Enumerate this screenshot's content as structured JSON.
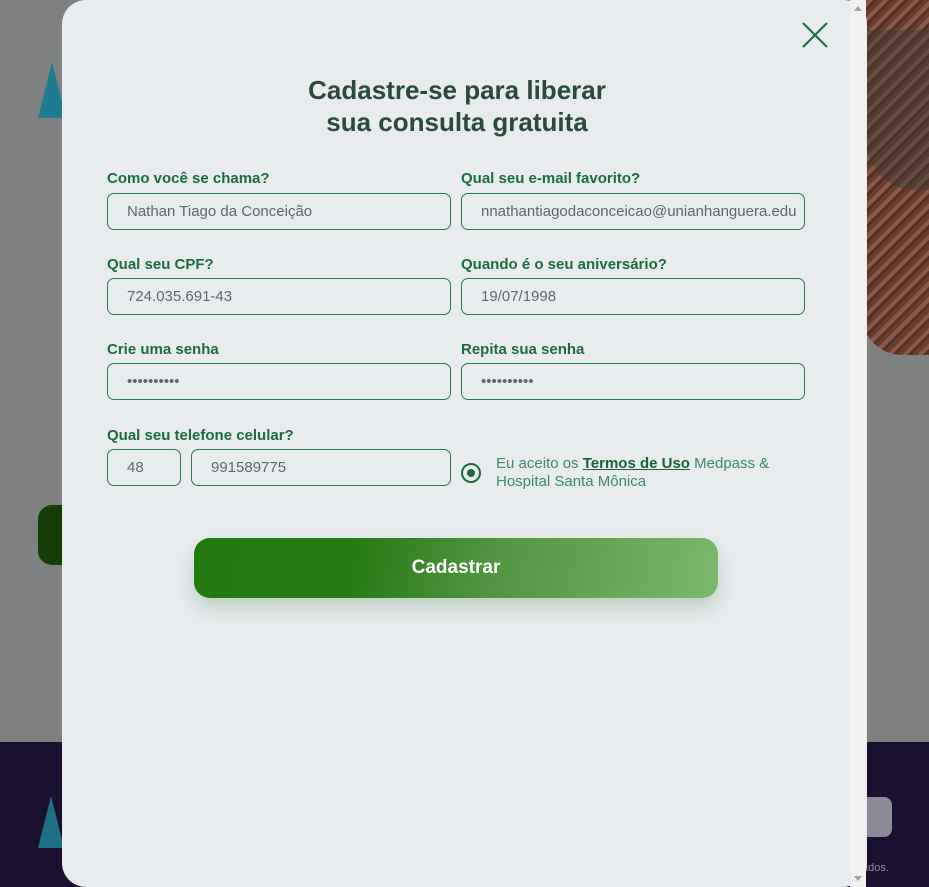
{
  "modal": {
    "title_line1": "Cadastre-se para liberar",
    "title_line2": "sua consulta gratuita",
    "close_icon": "close-icon"
  },
  "form": {
    "name": {
      "label": "Como você se chama?",
      "value": "Nathan Tiago da Conceição"
    },
    "email": {
      "label": "Qual seu e-mail favorito?",
      "value": "nnathantiagodaconceicao@unianhanguera.edu"
    },
    "cpf": {
      "label": "Qual seu CPF?",
      "value": "724.035.691-43"
    },
    "birthday": {
      "label": "Quando é o seu aniversário?",
      "value": "19/07/1998"
    },
    "password": {
      "label": "Crie uma senha",
      "value": "••••••••••"
    },
    "password_repeat": {
      "label": "Repita sua senha",
      "value": "••••••••••"
    },
    "phone": {
      "label": "Qual seu telefone celular?",
      "ddd": "48",
      "number": "991589775"
    },
    "terms": {
      "prefix": "Eu aceito os ",
      "link": "Termos de Uso",
      "suffix": " Medpass & Hospital Santa Mônica",
      "checked": true
    },
    "submit_label": "Cadastrar"
  },
  "background": {
    "footer_text": "ados."
  },
  "colors": {
    "accent": "#1e6b3c",
    "modal_bg": "#e8ecef",
    "button_start": "#237a12",
    "button_end": "#7bb86c"
  }
}
